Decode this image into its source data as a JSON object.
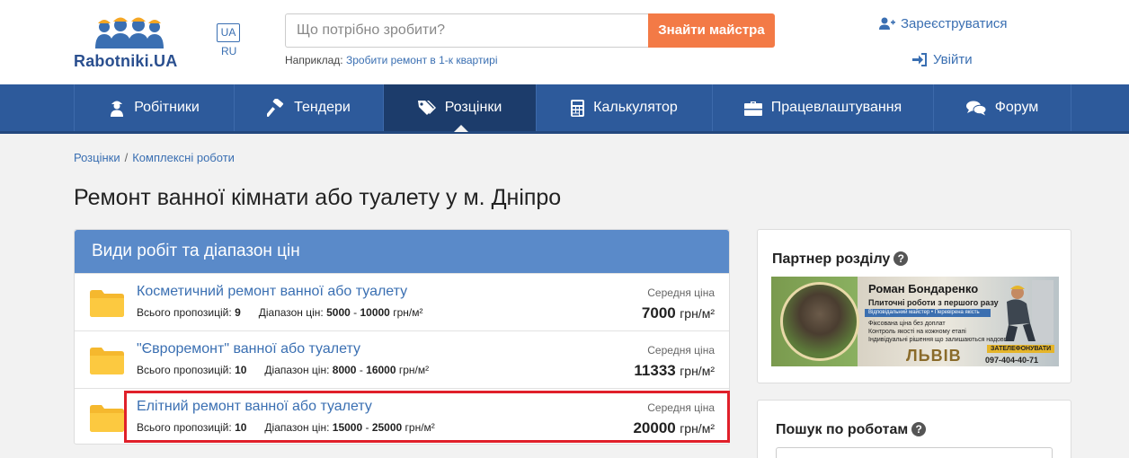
{
  "header": {
    "logo_text": "Rabotniki.UA",
    "lang_ua": "UA",
    "lang_ru": "RU",
    "search_placeholder": "Що потрібно зробити?",
    "search_button": "Знайти майстра",
    "example_label": "Наприклад:",
    "example_link": "Зробити ремонт в 1-к квартирі",
    "register": "Зареєструватися",
    "login": "Увійти"
  },
  "nav": {
    "items": [
      {
        "label": "Робітники",
        "icon": "worker-icon"
      },
      {
        "label": "Тендери",
        "icon": "hammer-icon"
      },
      {
        "label": "Розцінки",
        "icon": "tags-icon"
      },
      {
        "label": "Калькулятор",
        "icon": "calculator-icon"
      },
      {
        "label": "Працевлаштування",
        "icon": "briefcase-icon"
      },
      {
        "label": "Форум",
        "icon": "comments-icon"
      }
    ],
    "active_index": 2
  },
  "breadcrumb": {
    "items": [
      "Розцінки",
      "Комплексні роботи"
    ]
  },
  "page_title": "Ремонт ванної кімнати або туалету у м. Дніпро",
  "card": {
    "title": "Види робіт та діапазон цін",
    "count_label": "Всього пропозицій:",
    "range_label": "Діапазон цін:",
    "avg_label": "Середня ціна",
    "unit": "грн/м²",
    "rows": [
      {
        "title": "Косметичний ремонт ванної або туалету",
        "count": "9",
        "min": "5000",
        "max": "10000",
        "avg": "7000"
      },
      {
        "title": "\"Євроремонт\" ванної або туалету",
        "count": "10",
        "min": "8000",
        "max": "16000",
        "avg": "11333"
      },
      {
        "title": "Елітний ремонт ванної або туалету",
        "count": "10",
        "min": "15000",
        "max": "25000",
        "avg": "20000"
      }
    ]
  },
  "sidebar": {
    "partner_title": "Партнер розділу",
    "banner": {
      "name": "Роман Бондаренко",
      "sub": "Плиточні роботи з першого разу",
      "bar": "Відповідальний майстер • Перевірена якість",
      "bullets": [
        "Фіксована ціна без доплат",
        "Контроль якості на кожному етапі",
        "Індивідуальні рішення що залишаються надовго"
      ],
      "city": "ЛЬВІВ",
      "call": "ЗАТЕЛЕФОНУВАТИ",
      "phone": "097-404-40-71"
    },
    "search_title": "Пошук по роботам"
  },
  "colors": {
    "brand_blue": "#2d5a9b",
    "accent_orange": "#f37a46",
    "card_head": "#5a8ac9",
    "link": "#3a6fb2",
    "highlight_red": "#e0202a"
  }
}
